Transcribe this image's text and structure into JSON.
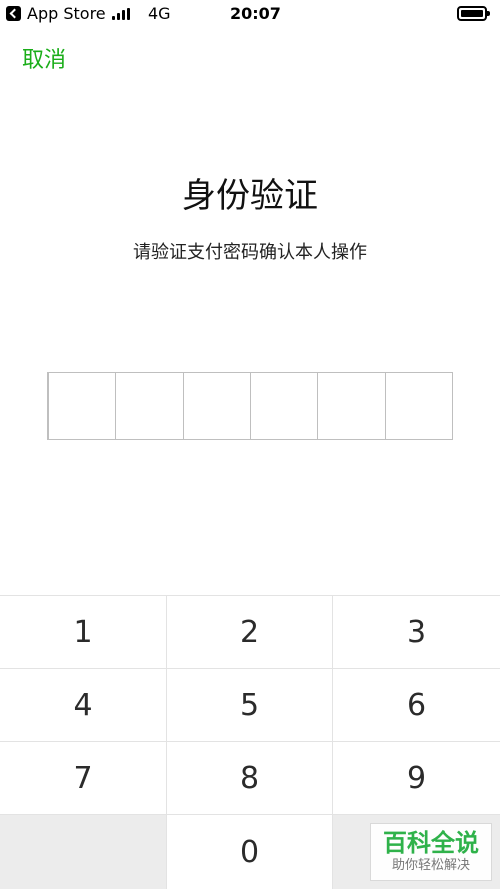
{
  "status_bar": {
    "back_app": "App Store",
    "network": "4G",
    "time": "20:07"
  },
  "header": {
    "cancel_label": "取消"
  },
  "main": {
    "title": "身份验证",
    "subtitle": "请验证支付密码确认本人操作",
    "pin_length": 6
  },
  "keypad": {
    "keys": [
      "1",
      "2",
      "3",
      "4",
      "5",
      "6",
      "7",
      "8",
      "9",
      "",
      "0",
      ""
    ]
  },
  "watermark": {
    "main": "百科全说",
    "sub": "助你轻松解决"
  },
  "colors": {
    "accent": "#1aad19",
    "watermark": "#2fb24a"
  },
  "icons": {
    "back": "chevron-left-icon",
    "signal": "signal-icon",
    "battery": "battery-icon"
  }
}
